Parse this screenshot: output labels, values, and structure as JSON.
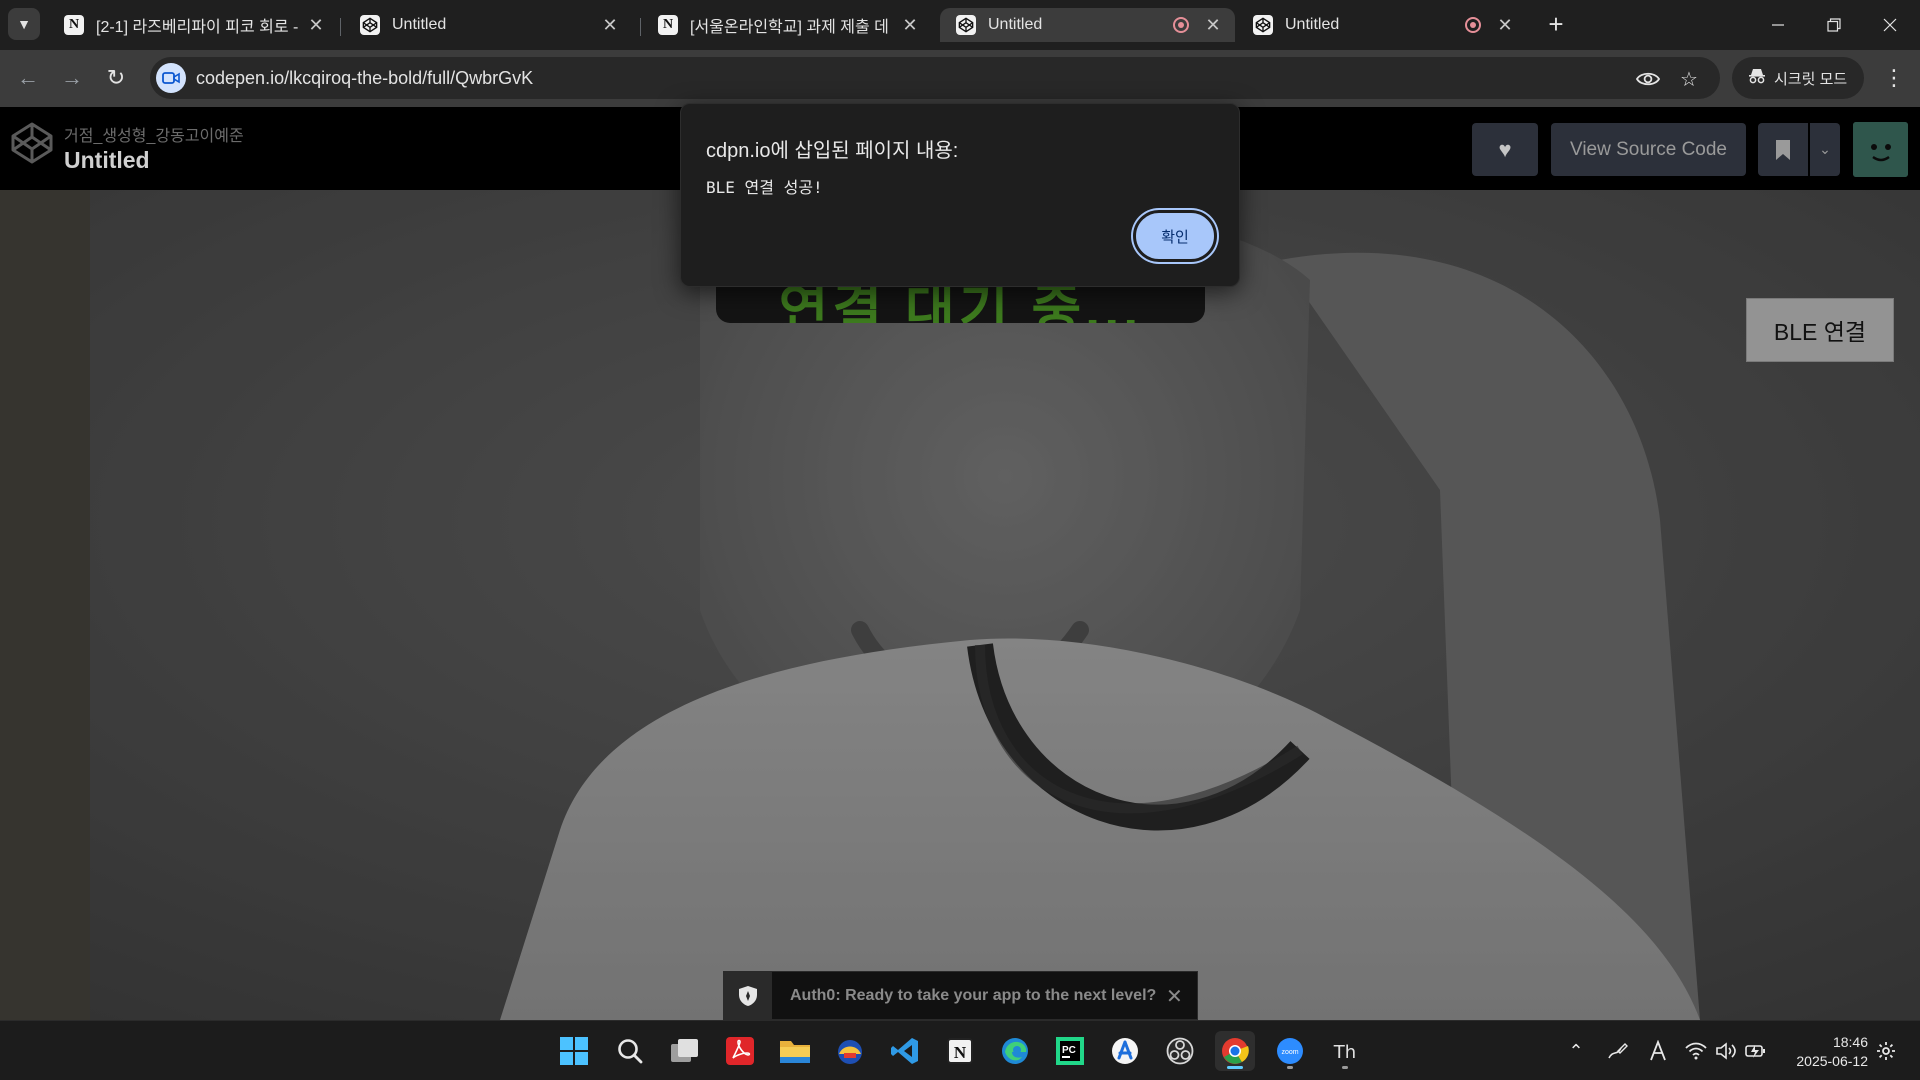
{
  "browser": {
    "tabs": [
      {
        "title": "[2-1] 라즈베리파이 피코 회로 -",
        "favicon": "notion",
        "active": false,
        "recording": false
      },
      {
        "title": "Untitled",
        "favicon": "codepen",
        "active": false,
        "recording": false
      },
      {
        "title": "[서울온라인학교] 과제 제출 데",
        "favicon": "notion",
        "active": false,
        "recording": false
      },
      {
        "title": "Untitled",
        "favicon": "codepen",
        "active": true,
        "recording": true
      },
      {
        "title": "Untitled",
        "favicon": "codepen",
        "active": false,
        "recording": true
      }
    ],
    "url": "codepen.io/lkcqiroq-the-bold/full/QwbrGvK",
    "incognito_label": "시크릿 모드"
  },
  "codepen": {
    "author": "거점_생성형_강동고이예준",
    "pen_title": "Untitled",
    "view_source_label": "View Source Code"
  },
  "app": {
    "ble_button_label": "BLE 연결",
    "status_text": "연결 대기 중..."
  },
  "dialog": {
    "title": "cdpn.io에 삽입된 페이지 내용:",
    "message": "BLE 연결 성공!",
    "ok_label": "확인"
  },
  "toast": {
    "text": "Auth0: Ready to take your app to the next level?"
  },
  "taskbar": {
    "apps": [
      "start-icon",
      "search-icon",
      "task-view-icon",
      "acrobat-icon",
      "file-explorer-icon",
      "app-icon",
      "vscode-icon",
      "notion-icon",
      "edge-icon",
      "pycharm-icon",
      "app-store-icon",
      "obs-icon",
      "chrome-icon",
      "zoom-icon",
      "thonny-icon"
    ],
    "time": "18:46",
    "date": "2025-06-12"
  },
  "colors": {
    "chrome_dark": "#3c3c3c",
    "dialog_button": "#a8c7fa",
    "status_green": "#3d7a1e"
  }
}
